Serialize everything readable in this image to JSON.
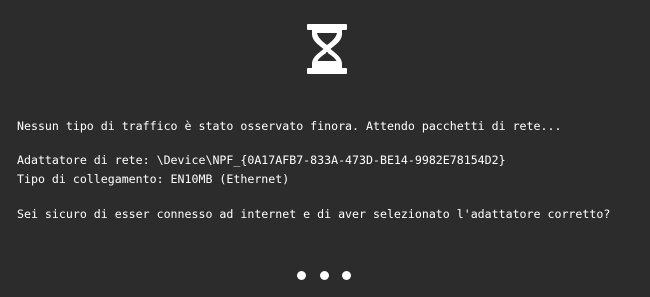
{
  "icons": {
    "status": "hourglass-icon",
    "loading": "loading-dots"
  },
  "colors": {
    "background": "#2c2c2c",
    "foreground": "#ffffff"
  },
  "messages": {
    "waiting": "Nessun tipo di traffico è stato osservato finora. Attendo pacchetti di rete...",
    "adapter": "Adattatore di rete: \\Device\\NPF_{0A17AFB7-833A-473D-BE14-9982E78154D2}",
    "link_type": "Tipo di collegamento: EN10MB (Ethernet)",
    "question": "Sei sicuro di esser connesso ad internet e di aver selezionato l'adattatore corretto?"
  }
}
